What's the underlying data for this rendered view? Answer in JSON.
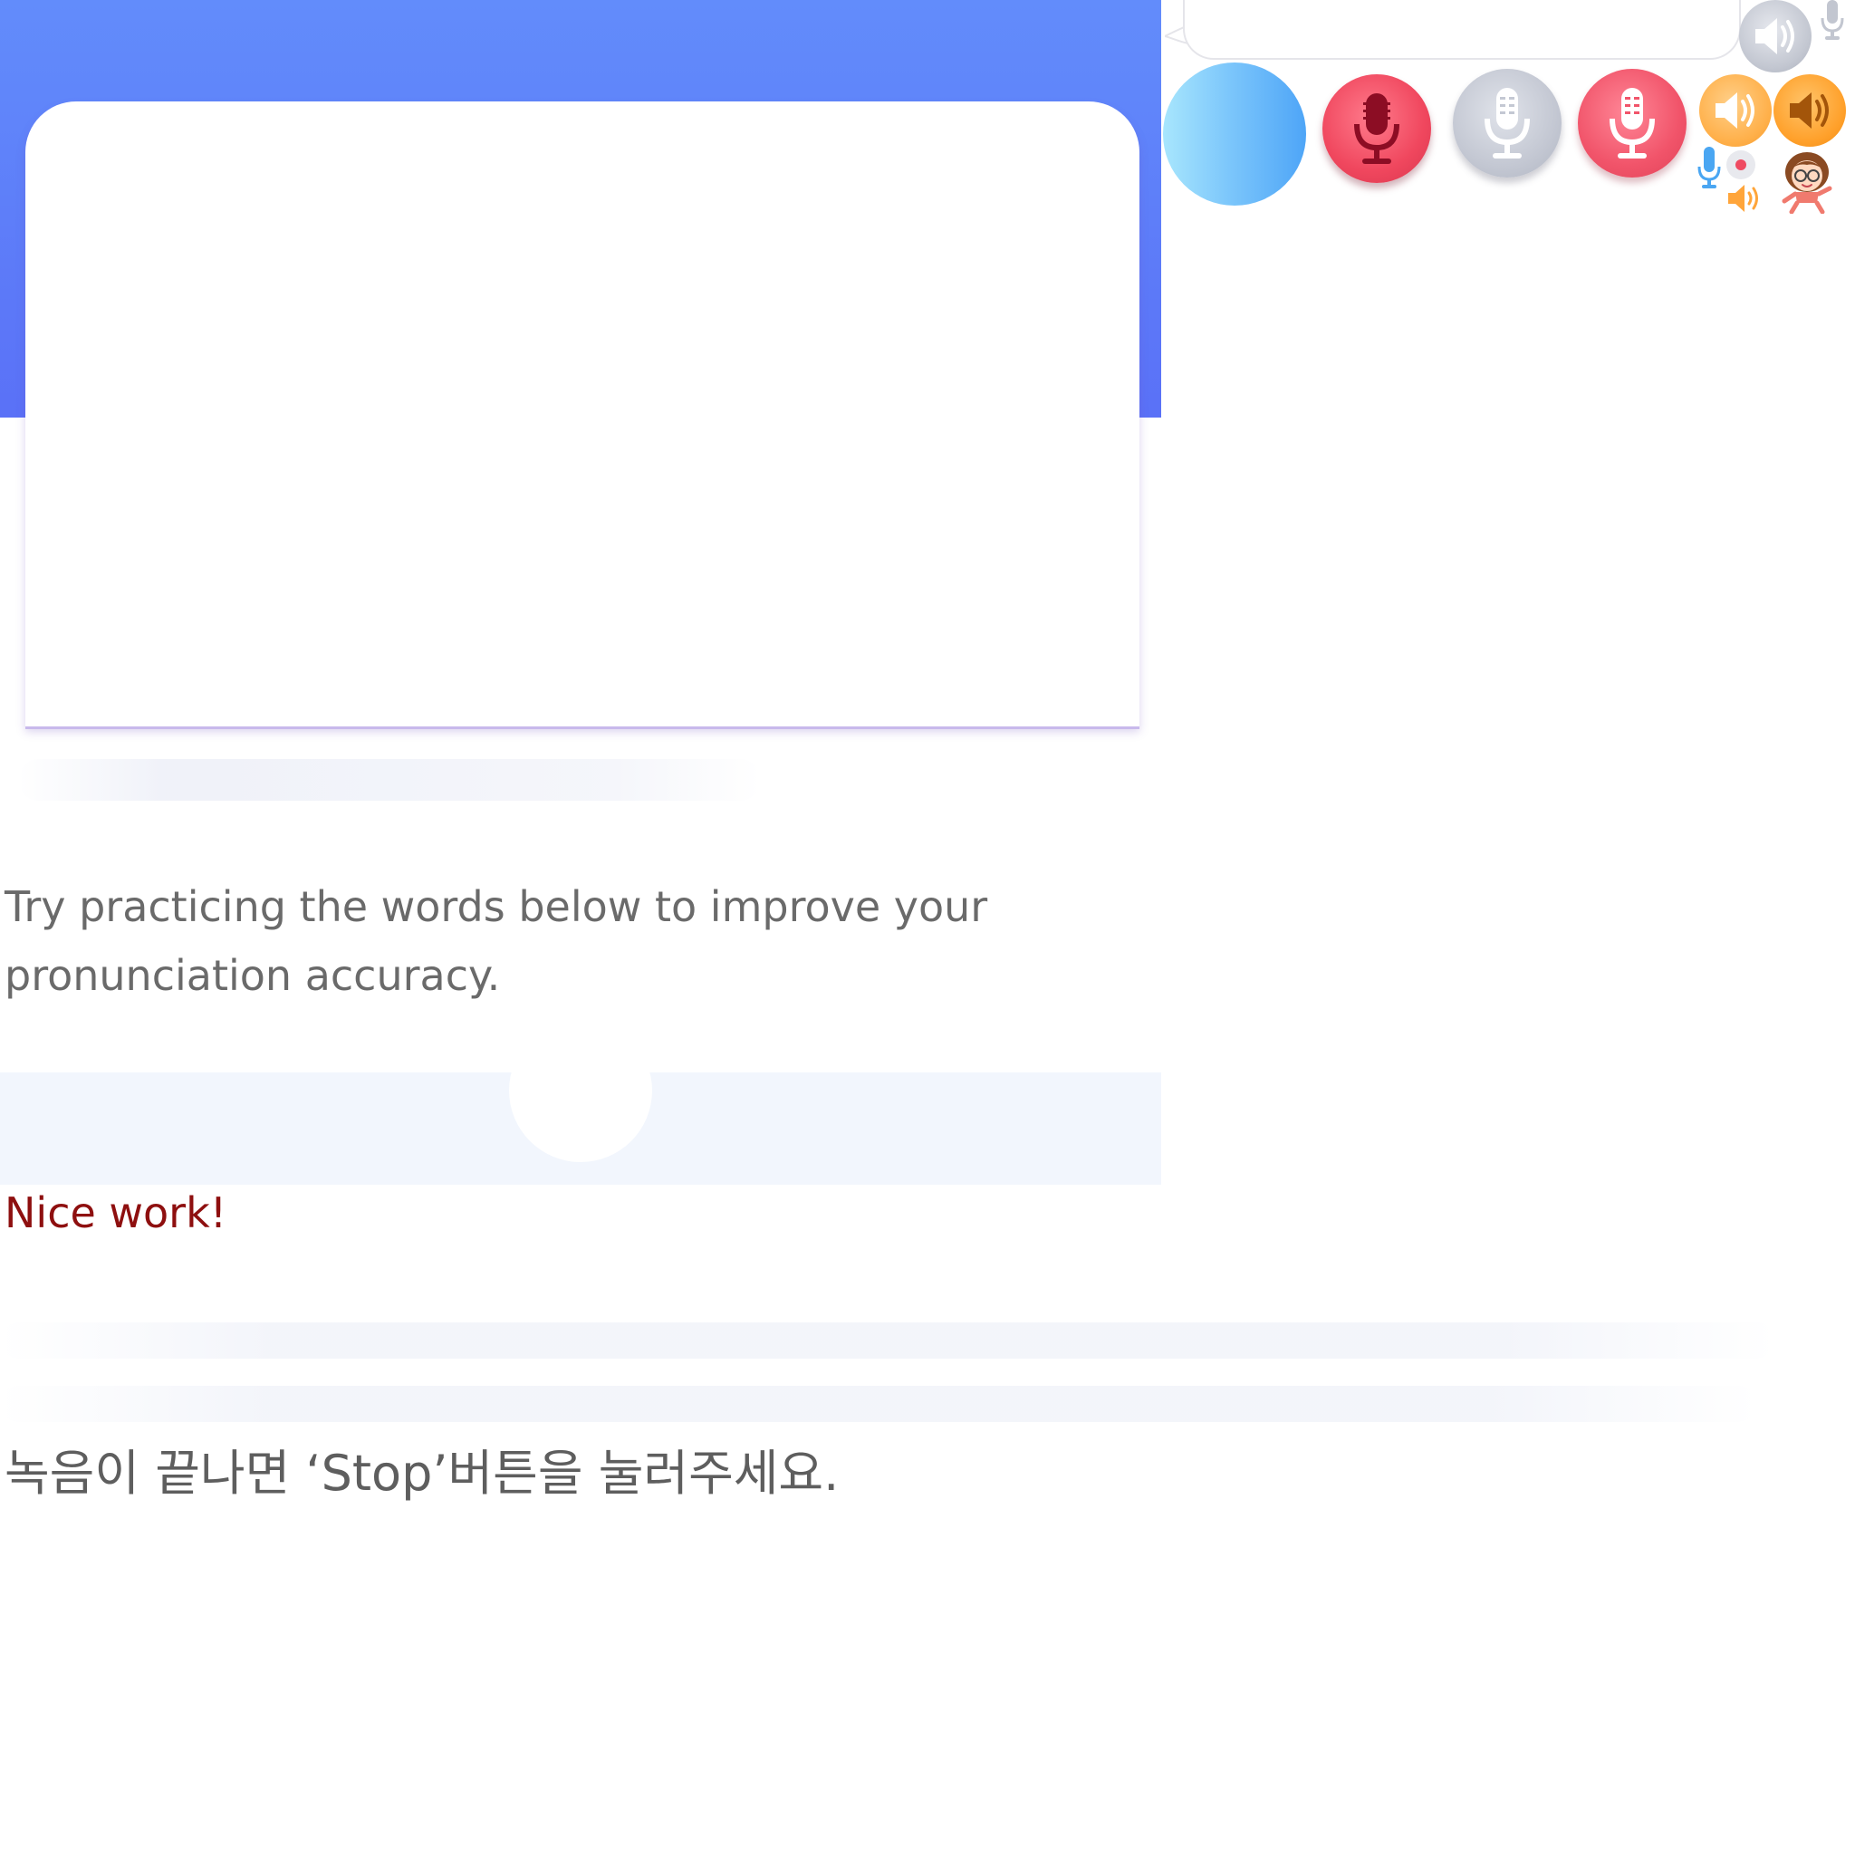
{
  "result": {
    "message": "Try practicing the words below to improve your pronunciation accuracy.",
    "feedback": "Nice work!"
  },
  "instructions": {
    "korean_hint": "녹음이 끝나면 ‘Stop’버튼을 눌러주세요."
  },
  "sprites": {
    "icons": [
      "speech-bubble",
      "mic-icon",
      "speaker-icon",
      "record-dot-icon",
      "teacher-avatar"
    ]
  },
  "colors": {
    "banner_top": "#628cfb",
    "banner_bottom": "#5a71f7",
    "feedback_text": "#8e0f0f",
    "body_text": "#6a6a6a",
    "score_band": "#f2f6fd",
    "mic_red": "#f0475e",
    "speaker_orange": "#ffa02a"
  }
}
